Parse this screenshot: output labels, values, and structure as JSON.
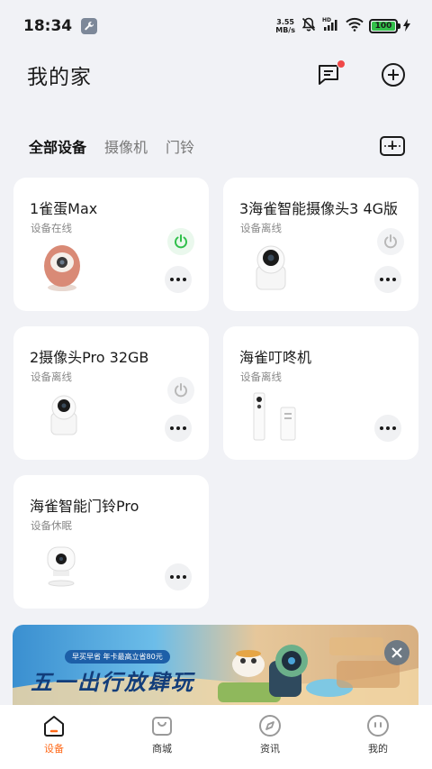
{
  "status_bar": {
    "time": "18:34",
    "net_speed_value": "3.55",
    "net_speed_unit": "MB/s",
    "battery": "100"
  },
  "header": {
    "title": "我的家"
  },
  "tabs": [
    {
      "label": "全部设备"
    },
    {
      "label": "摄像机"
    },
    {
      "label": "门铃"
    }
  ],
  "devices": [
    {
      "name": "1雀蛋Max",
      "status": "设备在线"
    },
    {
      "name": "3海雀智能摄像头3 4G版",
      "status": "设备离线"
    },
    {
      "name": "2摄像头Pro 32GB",
      "status": "设备离线"
    },
    {
      "name": "海雀叮咚机",
      "status": "设备离线"
    },
    {
      "name": "海雀智能门铃Pro",
      "status": "设备休眠"
    }
  ],
  "banner": {
    "pill_text": "早买早省 年卡最高立省80元",
    "headline": "五一出行放肆玩"
  },
  "bottom_nav": [
    {
      "label": "设备",
      "icon": "home-icon"
    },
    {
      "label": "商城",
      "icon": "shop-bag-icon"
    },
    {
      "label": "资讯",
      "icon": "compass-icon"
    },
    {
      "label": "我的",
      "icon": "profile-icon"
    }
  ],
  "colors": {
    "accent": "#ff6a1a",
    "online": "#2fbf4a",
    "background": "#f1f2f6"
  }
}
